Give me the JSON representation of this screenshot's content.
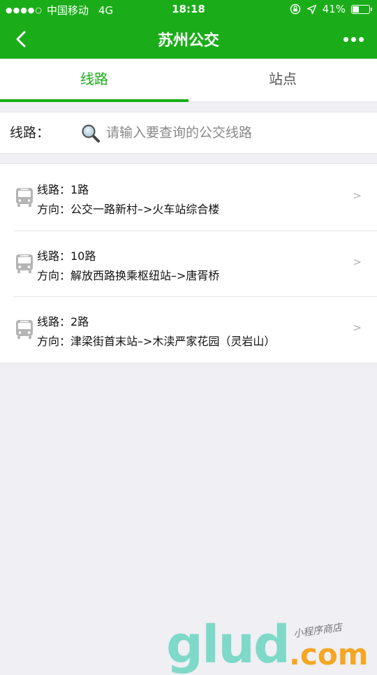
{
  "status_bar": {
    "signal": "●●●●○",
    "carrier": "中国移动",
    "network": "4G",
    "time": "18:18",
    "battery_text": "41%",
    "battery_level": 0.41
  },
  "nav": {
    "title": "苏州公交"
  },
  "tabs": [
    {
      "label": "线路",
      "active": true
    },
    {
      "label": "站点",
      "active": false
    }
  ],
  "search": {
    "label": "线路：",
    "placeholder": "请输入要查询的公交线路",
    "value": ""
  },
  "routes": [
    {
      "line": "线路：1路",
      "direction": "方向：公交一路新村–>火车站综合楼"
    },
    {
      "line": "线路：10路",
      "direction": "方向：解放西路换乘枢纽站–>唐胥桥"
    },
    {
      "line": "线路：2路",
      "direction": "方向：津梁街首末站–>木渎严家花园（灵岩山）"
    }
  ],
  "chevron_glyph": ">",
  "watermark": {
    "logo": "glud",
    "domain": ".com",
    "tagline": "小程序商店"
  },
  "colors": {
    "brand_green": "#1aad19",
    "background": "#efeff4"
  }
}
